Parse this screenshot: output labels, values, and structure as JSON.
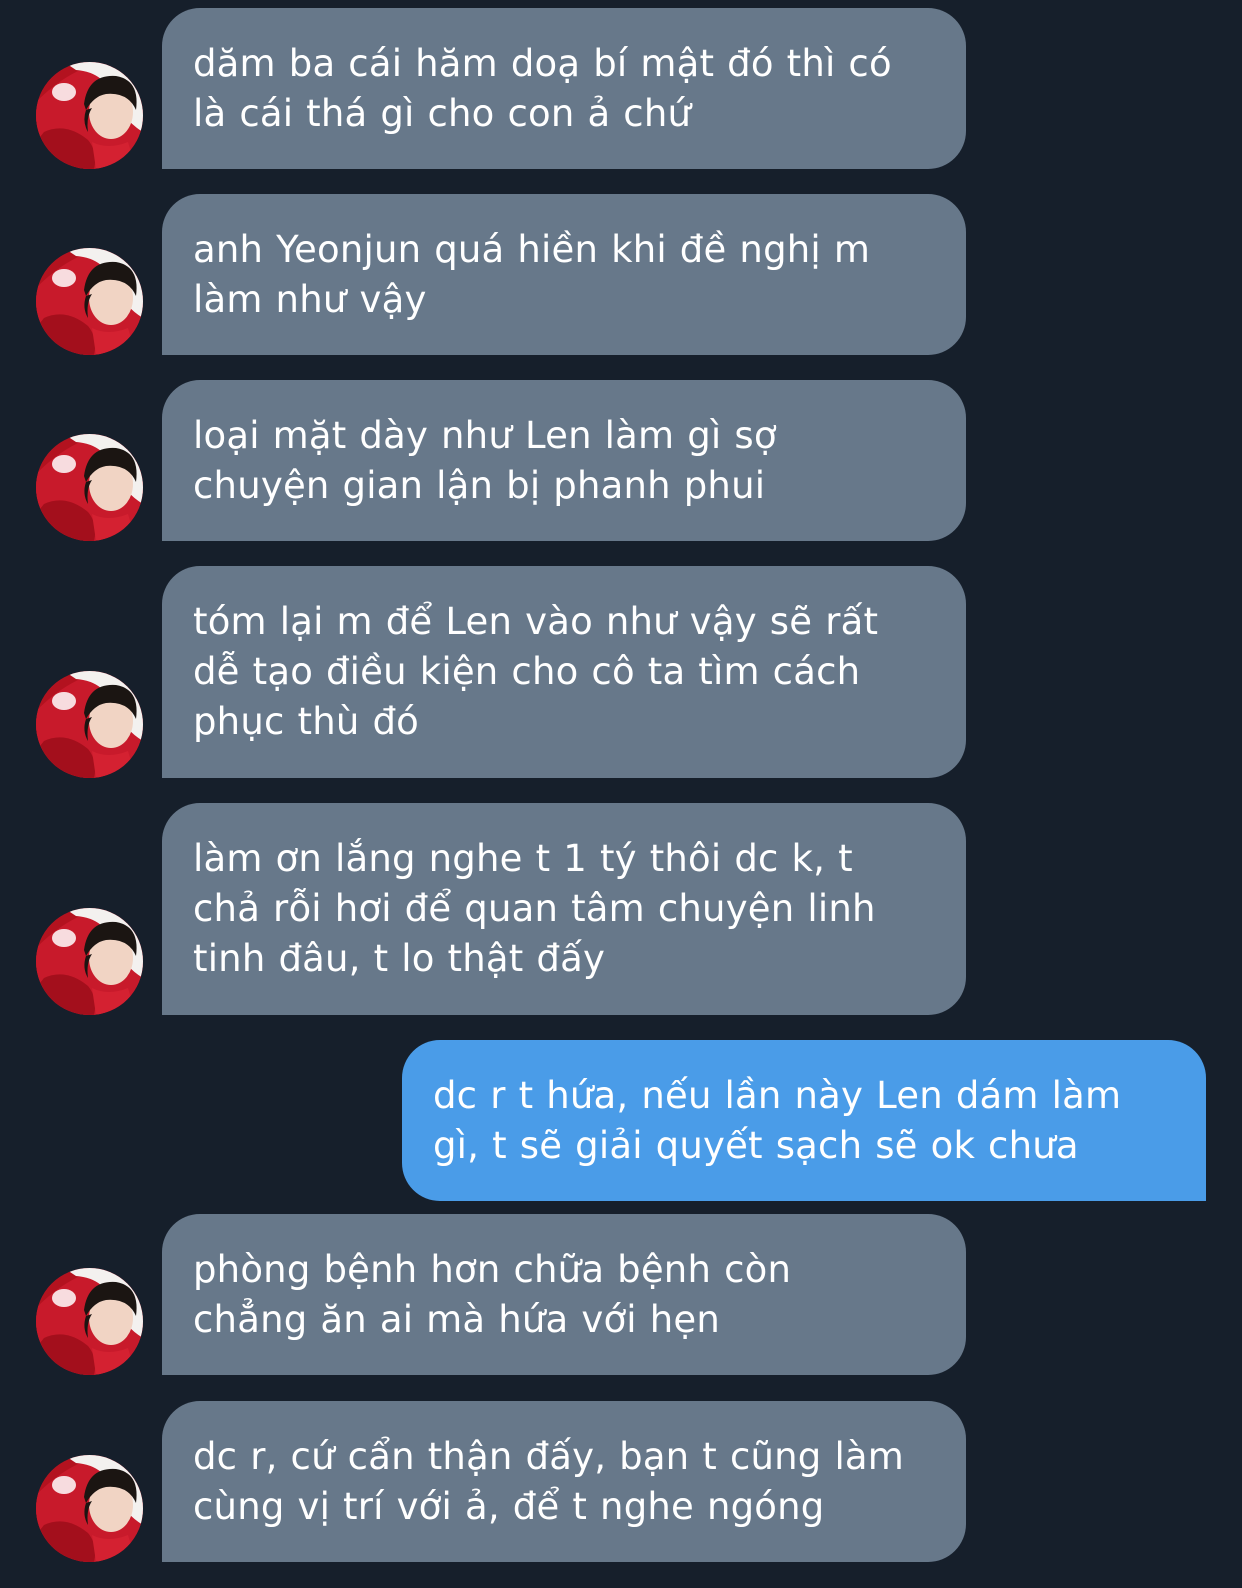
{
  "colors": {
    "background": "#161f2b",
    "incoming_bubble": "#67788a",
    "outgoing_bubble": "#4a9ce8",
    "text": "#ffffff"
  },
  "avatar_icon": "contact-avatar-photo",
  "messages": [
    {
      "sender": "other",
      "text": "dăm ba cái hăm doạ bí mật đó thì có\nlà cái thá gì cho con ả chứ"
    },
    {
      "sender": "other",
      "text": "anh Yeonjun quá hiền khi đề nghị m\nlàm như vậy"
    },
    {
      "sender": "other",
      "text": "loại mặt dày như Len làm gì sợ\nchuyện gian lận bị phanh phui"
    },
    {
      "sender": "other",
      "text": "tóm lại m để Len vào như vậy sẽ rất\ndễ tạo điều kiện cho cô ta tìm cách\nphục thù đó"
    },
    {
      "sender": "other",
      "text": "làm ơn lắng nghe t 1 tý thôi dc k, t\nchả rỗi hơi để quan tâm chuyện linh\ntinh đâu, t lo thật đấy"
    },
    {
      "sender": "me",
      "text": "dc r t hứa, nếu lần này Len dám làm\ngì, t sẽ giải quyết sạch sẽ ok chưa"
    },
    {
      "sender": "other",
      "text": "phòng bệnh hơn chữa bệnh còn\nchẳng ăn ai mà hứa với hẹn"
    },
    {
      "sender": "other",
      "text": "dc r, cứ cẩn thận đấy, bạn t cũng làm\ncùng vị trí với ả, để t nghe ngóng"
    }
  ]
}
